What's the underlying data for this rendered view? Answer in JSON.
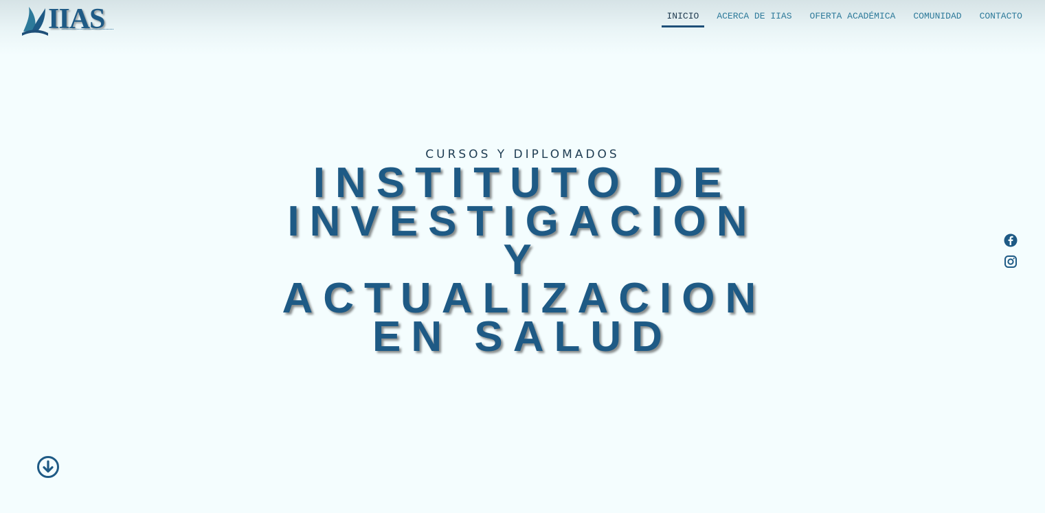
{
  "brand": {
    "logo_text": "IIAS"
  },
  "nav": {
    "items": [
      {
        "label": "INICIO",
        "active": true
      },
      {
        "label": "ACERCA DE IIAS",
        "active": false
      },
      {
        "label": "OFERTA ACADÉMICA",
        "active": false
      },
      {
        "label": "COMUNIDAD",
        "active": false
      },
      {
        "label": "CONTACTO",
        "active": false
      }
    ]
  },
  "hero": {
    "kicker": "CURSOS Y DIPLOMADOS",
    "title": "INSTITUTO DE INVESTIGACION Y ACTUALIZACION EN SALUD"
  },
  "social": {
    "icons": [
      "facebook-icon",
      "instagram-icon"
    ]
  },
  "scroll": {
    "icon": "arrow-down-circle-icon"
  },
  "colors": {
    "brand_blue": "#1e5a85",
    "nav_teal": "#2d7a9a",
    "background": "#f4fdfe"
  }
}
